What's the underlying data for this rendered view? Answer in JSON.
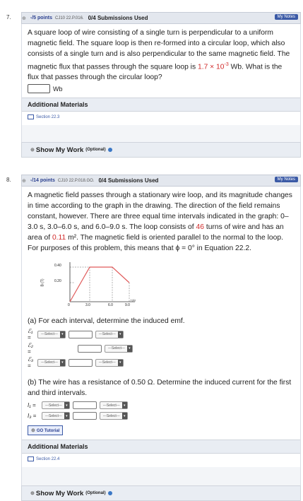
{
  "q7": {
    "number": "7.",
    "points": "-/5 points",
    "code": "CJ10 22.P.016.",
    "submissions": "0/4 Submissions Used",
    "notes": "My Notes",
    "p1": "A square loop of wire consisting of a single turn is perpendicular to a uniform magnetic field. The square loop is then re-formed into a circular loop, which also consists of a single turn and is also perpendicular to the same magnetic field. The magnetic flux that passes through the square loop is",
    "flux": "1.7 × 10",
    "flux_exp": "-3",
    "p2": " Wb. What is the flux that passes through the circular loop?",
    "unit": "Wb",
    "addl": "Additional Materials",
    "section": "Section 22.3",
    "smw": "Show My Work",
    "opt": "(Optional)"
  },
  "q8": {
    "number": "8.",
    "points": "-/14 points",
    "code": "CJ10 22.P.018.GO.",
    "submissions": "0/4 Submissions Used",
    "notes": "My Notes",
    "p1": "A magnetic field passes through a stationary wire loop, and its magnitude changes in time according to the graph in the drawing. The direction of the field remains constant, however. There are three equal time intervals indicated in the graph: 0–3.0 s, 3.0–6.0 s, and 6.0–9.0 s. The loop consists of",
    "turns": "46",
    "p2": " turns of wire and has an area of",
    "area": "0.11",
    "p3": " m². The magnetic field is oriented parallel to the normal to the loop. For purposes of this problem, this means that ϕ = 0° in Equation 22.2.",
    "graph": {
      "ylabel": "B (T)",
      "xlabel": "t (s)",
      "yticks": [
        "0.40",
        "0.20"
      ],
      "xticks": [
        "0",
        "3.0",
        "6.0",
        "9.0"
      ]
    },
    "a_prompt": "(a) For each interval, determine the induced emf.",
    "a_labels": [
      "ℰ₁ =",
      "ℰ₂ =",
      "ℰ₃ ="
    ],
    "select": "---Select---",
    "b_prompt": "(b) The wire has a resistance of 0.50 Ω. Determine the induced current for the first and third intervals.",
    "b_labels": [
      "I₁ =",
      "I₃ ="
    ],
    "tutorial": "GO Tutorial",
    "addl": "Additional Materials",
    "section": "Section 22.4",
    "smw": "Show My Work",
    "opt": "(Optional)"
  }
}
